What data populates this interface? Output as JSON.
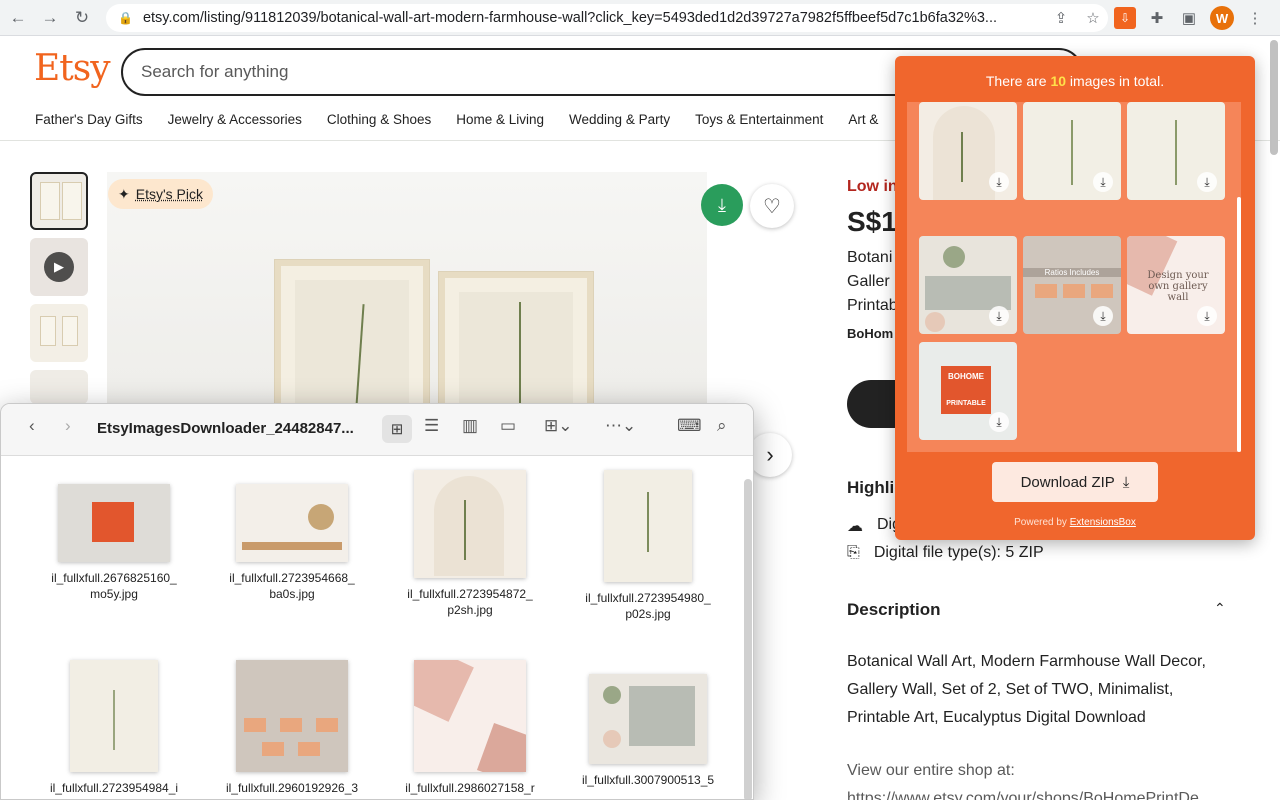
{
  "browser": {
    "url": "etsy.com/listing/911812039/botanical-wall-art-modern-farmhouse-wall?click_key=5493ded1d2d39727a7982f5ffbeef5d7c1b6fa32%3...",
    "avatar_letter": "W"
  },
  "etsy": {
    "logo": "Etsy",
    "search_placeholder": "Search for anything",
    "categories": [
      "Father's Day Gifts",
      "Jewelry & Accessories",
      "Clothing & Shoes",
      "Home & Living",
      "Wedding & Party",
      "Toys & Entertainment",
      "Art &"
    ],
    "badge": "Etsy's Pick",
    "low_stock": "Low in",
    "price": "S$1",
    "title_lines": [
      "Botani",
      "Galler",
      "Printab"
    ],
    "shop": "BoHom",
    "highlights_heading": "Highligh",
    "highlight_1": "Dig",
    "highlight_2": "Digital file type(s): 5 ZIP",
    "description_heading": "Description",
    "description": "Botanical Wall Art, Modern Farmhouse Wall Decor, Gallery Wall, Set of 2, Set of TWO, Minimalist, Printable Art, Eucalyptus Digital Download",
    "shop_line": "View our entire shop at:",
    "shop_url": "https://www.etsy.com/your/shops/BoHomePrintDe"
  },
  "popup": {
    "title_prefix": "There are ",
    "count": "10",
    "title_suffix": " images in total.",
    "download_zip": "Download ZIP",
    "powered_prefix": "Powered by ",
    "powered_link": "ExtensionsBox",
    "image_texts": {
      "ratios": "Ratios Includes",
      "design": "Design your own gallery wall",
      "bohome": "BOHOME",
      "printable": "PRINTABLE"
    }
  },
  "finder": {
    "title": "EtsyImagesDownloader_24482847...",
    "files": [
      {
        "name": "il_fullxfull.2676825160_\nmo5y.jpg"
      },
      {
        "name": "il_fullxfull.2723954668_\nba0s.jpg"
      },
      {
        "name": "il_fullxfull.2723954872_\np2sh.jpg"
      },
      {
        "name": "il_fullxfull.2723954980_\np02s.jpg"
      },
      {
        "name": "il_fullxfull.2723954984_i"
      },
      {
        "name": "il_fullxfull.2960192926_3"
      },
      {
        "name": "il_fullxfull.2986027158_r"
      },
      {
        "name": "il_fullxfull.3007900513_5"
      }
    ]
  },
  "colors": {
    "etsy_orange": "#f1641e",
    "popup_orange": "#f0662d",
    "count_yellow": "#ffe14a",
    "download_green": "#2a9d5c"
  }
}
